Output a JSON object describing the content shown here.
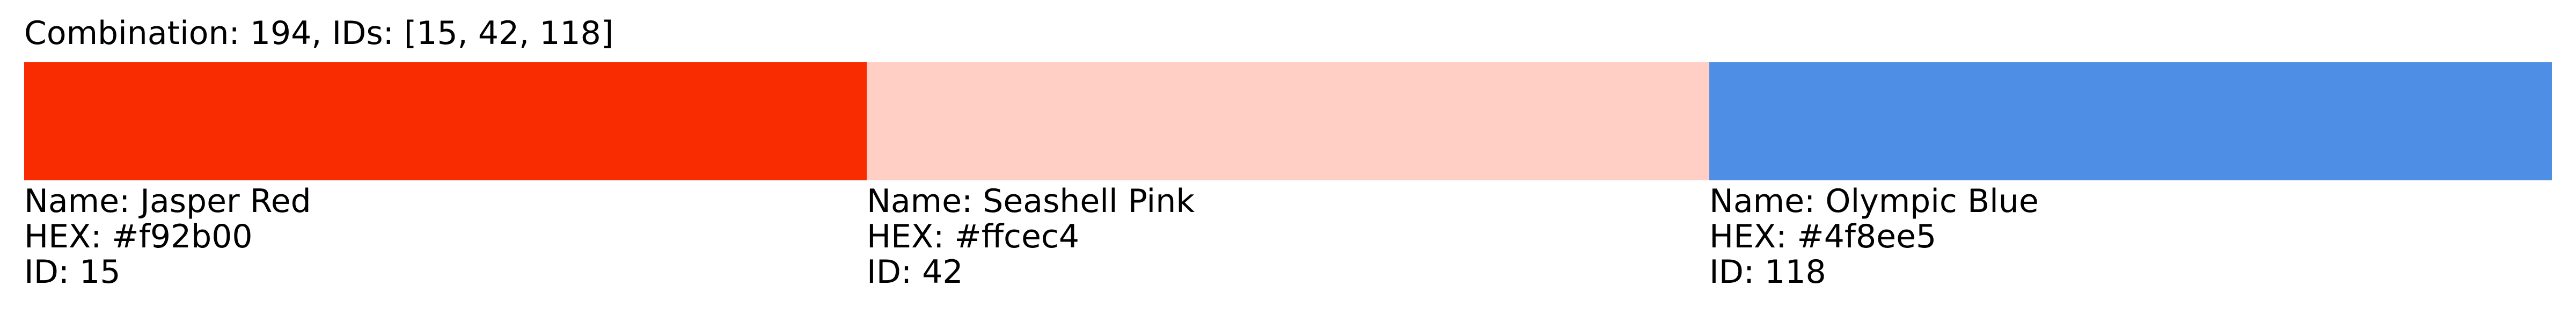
{
  "title": "Combination: 194, IDs: [15, 42, 118]",
  "colors": [
    {
      "hex": "#f92b00",
      "name_line": "Name: Jasper Red",
      "hex_line": "HEX: #f92b00",
      "id_line": "ID: 15"
    },
    {
      "hex": "#ffcec4",
      "name_line": "Name: Seashell Pink",
      "hex_line": "HEX: #ffcec4",
      "id_line": "ID: 42"
    },
    {
      "hex": "#4f8ee5",
      "name_line": "Name: Olympic Blue",
      "hex_line": "HEX: #4f8ee5",
      "id_line": "ID: 118"
    }
  ]
}
